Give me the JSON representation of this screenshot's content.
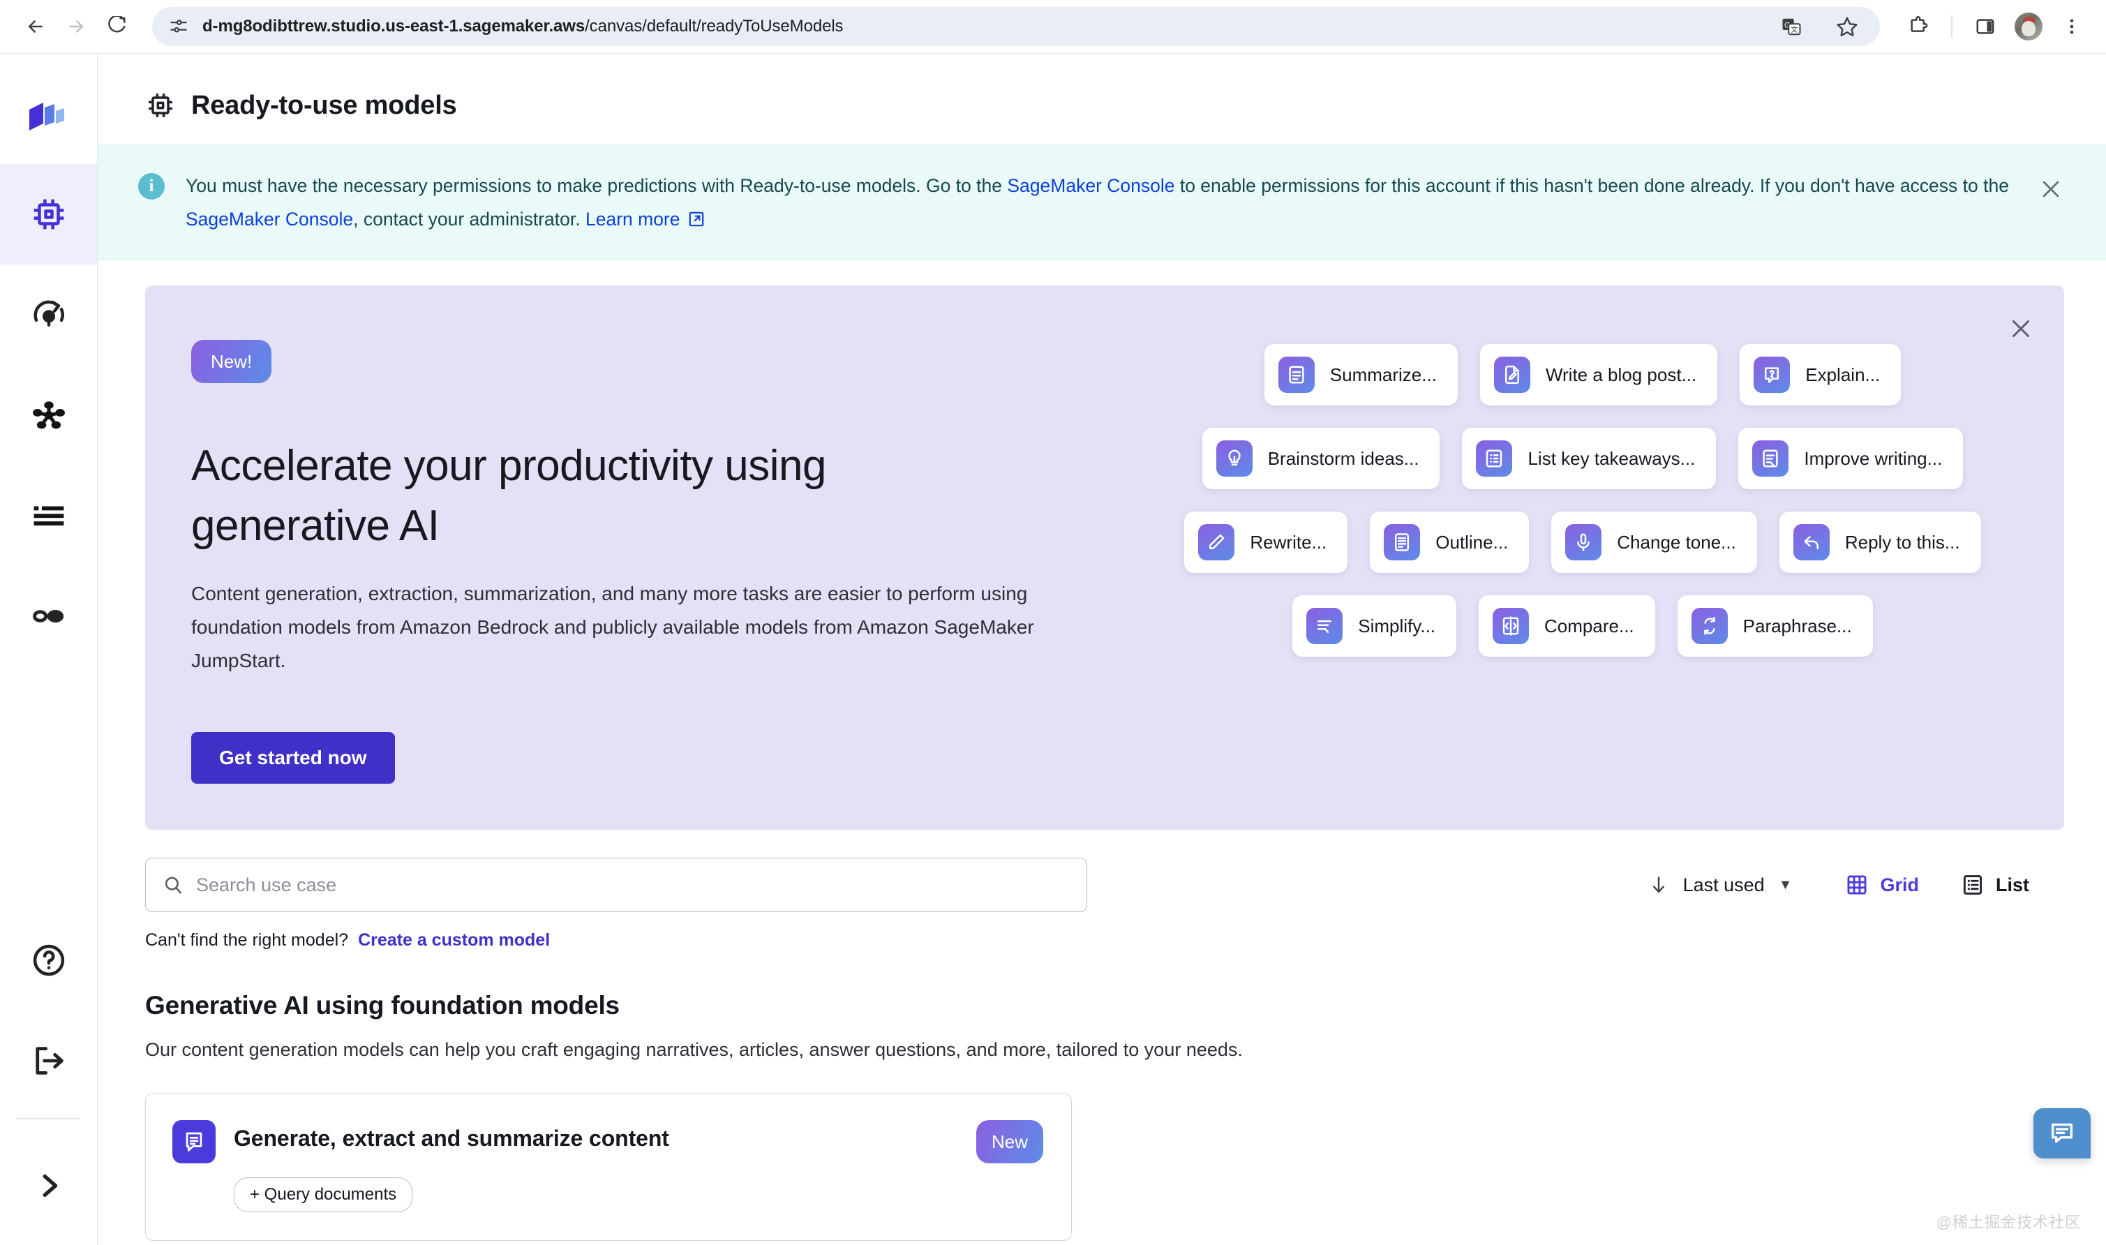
{
  "browser": {
    "url_prefix": "d-mg8odibttrew.studio.us-east-1.sagemaker.aws",
    "url_suffix": "/canvas/default/readyToUseModels",
    "back_icon": "back-arrow-icon",
    "forward_icon": "forward-arrow-icon",
    "reload_icon": "reload-icon",
    "site_settings_icon": "site-settings-icon",
    "translate_icon": "translate-icon",
    "bookmark_icon": "star-icon",
    "extensions_icon": "puzzle-icon",
    "side_panel_icon": "side-panel-icon",
    "profile_icon": "avatar-icon",
    "menu_icon": "three-dot-menu-icon"
  },
  "rail": {
    "items": [
      {
        "name": "logo",
        "icon": "sagemaker-logo-icon",
        "active": false
      },
      {
        "name": "ready-to-use-models",
        "icon": "chip-icon",
        "active": true
      },
      {
        "name": "my-models",
        "icon": "model-refresh-icon",
        "active": false
      },
      {
        "name": "datasets",
        "icon": "nodes-icon",
        "active": false
      },
      {
        "name": "data-wrangler",
        "icon": "list-icon",
        "active": false
      },
      {
        "name": "predictions",
        "icon": "circles-icon",
        "active": false
      }
    ],
    "bottom_items": [
      {
        "name": "help",
        "icon": "question-circle-icon"
      },
      {
        "name": "logout",
        "icon": "logout-icon"
      }
    ],
    "expand": {
      "name": "expand-sidebar",
      "icon": "chevron-right-icon"
    }
  },
  "header": {
    "title": "Ready-to-use models",
    "icon": "chip-icon"
  },
  "info_banner": {
    "icon": "info-icon",
    "part1": "You must have the necessary permissions to make predictions with Ready-to-use models. Go to the ",
    "link1": "SageMaker Console",
    "part2": " to enable permissions for this account if this hasn't been done already. If you don't have access to the ",
    "link2": "SageMaker Console",
    "part3": ", contact your administrator. ",
    "link3": "Learn more",
    "close_label": "✕"
  },
  "hero": {
    "badge": "New!",
    "title": "Accelerate your productivity using generative AI",
    "description": "Content generation, extraction, summarization, and many more tasks are easier to perform using foundation models from Amazon Bedrock and publicly available models from Amazon SageMaker JumpStart.",
    "cta": "Get started now",
    "close_label": "✕",
    "chip_rows": [
      [
        {
          "label": "Summarize...",
          "icon": "summarize-icon"
        },
        {
          "label": "Write a blog post...",
          "icon": "write-doc-icon"
        },
        {
          "label": "Explain...",
          "icon": "explain-icon"
        }
      ],
      [
        {
          "label": "Brainstorm ideas...",
          "icon": "lightbulb-icon"
        },
        {
          "label": "List key takeaways...",
          "icon": "bullet-list-icon"
        },
        {
          "label": "Improve writing...",
          "icon": "improve-writing-icon"
        }
      ],
      [
        {
          "label": "Rewrite...",
          "icon": "pencil-icon"
        },
        {
          "label": "Outline...",
          "icon": "outline-icon"
        },
        {
          "label": "Change tone...",
          "icon": "microphone-icon"
        },
        {
          "label": "Reply to this...",
          "icon": "reply-arrow-icon"
        }
      ],
      [
        {
          "label": "Simplify...",
          "icon": "simplify-icon"
        },
        {
          "label": "Compare...",
          "icon": "compare-icon"
        },
        {
          "label": "Paraphrase...",
          "icon": "paraphrase-icon"
        }
      ]
    ]
  },
  "toolbar": {
    "search_placeholder": "Search use case",
    "search_value": "",
    "search_icon": "search-icon",
    "helper_text": "Can't find the right model?",
    "helper_link": "Create a custom model",
    "sort_icon": "arrow-down-icon",
    "sort_label": "Last used",
    "sort_caret": "▼",
    "grid_label": "Grid",
    "grid_icon": "grid-icon",
    "list_label": "List",
    "list_icon": "list-view-icon"
  },
  "section": {
    "title": "Generative AI using foundation models",
    "description": "Our content generation models can help you craft engaging narratives, articles, answer questions, and more, tailored to your needs."
  },
  "cards": [
    {
      "title": "Generate, extract and summarize content",
      "badge": "New",
      "icon": "chat-document-icon",
      "tags": [
        "+ Query documents"
      ]
    }
  ],
  "chat_fab": {
    "icon": "chat-bubble-icon"
  },
  "watermark": "@稀土掘金技术社区",
  "colors": {
    "accent": "#3f31c8",
    "accent_light": "#4b3bdd",
    "hero_bg": "#e4e0f5",
    "info_bg": "#eafaf9",
    "info_icon": "#5cbdd0",
    "link": "#0d41d6",
    "chat_fab": "#4f8fcd"
  }
}
